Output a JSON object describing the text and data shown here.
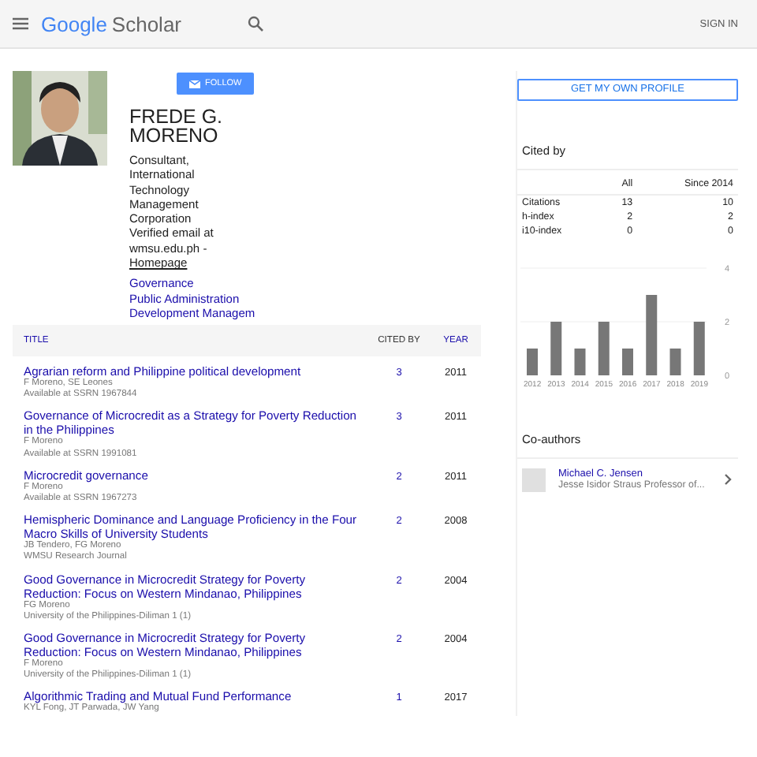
{
  "header": {
    "logo_google": "Google",
    "logo_scholar": "Scholar",
    "sign_in": "SIGN IN"
  },
  "profile": {
    "follow": "FOLLOW",
    "name": "FREDE G. MORENO",
    "affiliation": "Consultant, International Technology Management Corporation",
    "email": "Verified email at wmsu.edu.ph -",
    "homepage": "Homepage",
    "interests": [
      "Governance",
      "Public Administration",
      "Development Managem"
    ]
  },
  "articles": {
    "columns": [
      "TITLE",
      "CITED BY",
      "YEAR"
    ],
    "rows": [
      {
        "title": "Agrarian reform and Philippine political development",
        "authors": "F Moreno, SE Leones",
        "venue": "Available at SSRN 1967844",
        "cited_by": "3",
        "year": "2011"
      },
      {
        "title": "Governance of Microcredit as a Strategy for Poverty Reduction in the Philippines",
        "authors": "F Moreno",
        "venue": "Available at SSRN 1991081",
        "cited_by": "3",
        "year": "2011"
      },
      {
        "title": "Microcredit governance",
        "authors": "F Moreno",
        "venue": "Available at SSRN 1967273",
        "cited_by": "2",
        "year": "2011"
      },
      {
        "title": "Hemispheric Dominance and Language Proficiency in the Four Macro Skills of University Students",
        "authors": "JB Tendero, FG Moreno",
        "venue": "WMSU Research Journal",
        "cited_by": "2",
        "year": "2008"
      },
      {
        "title": "Good Governance in Microcredit Strategy for Poverty Reduction: Focus on Western Mindanao, Philippines",
        "authors": "FG Moreno",
        "venue": "University of the Philippines-Diliman 1 (1)",
        "cited_by": "2",
        "year": "2004"
      },
      {
        "title": "Good Governance in Microcredit Strategy for Poverty Reduction: Focus on Western Mindanao, Philippines",
        "authors": "F Moreno",
        "venue": "University of the Philippines-Diliman 1 (1)",
        "cited_by": "2",
        "year": "2004"
      },
      {
        "title": "Algorithmic Trading and Mutual Fund Performance",
        "authors": "KYL Fong, JT Parwada, JW Yang",
        "cited_by": "1",
        "year": "2017"
      }
    ]
  },
  "sidebar": {
    "get_profile": "GET MY OWN PROFILE",
    "cited_by": {
      "title": "Cited by",
      "columns": [
        "",
        "All",
        "Since 2014"
      ],
      "rows": [
        [
          "Citations",
          "13",
          "10"
        ],
        [
          "h-index",
          "2",
          "2"
        ],
        [
          "i10-index",
          "0",
          "0"
        ]
      ],
      "chart_data": {
        "type": "bar",
        "categories": [
          "2012",
          "2013",
          "2014",
          "2015",
          "2016",
          "2017",
          "2018",
          "2019"
        ],
        "values": [
          1,
          2,
          1,
          2,
          1,
          3,
          1,
          2
        ],
        "ylim": [
          0,
          4
        ],
        "yticks": [
          0,
          2,
          4
        ]
      }
    },
    "coauthors": {
      "title": "Co-authors",
      "items": [
        {
          "name": "Michael C. Jensen",
          "description": "Jesse Isidor Straus Professor of..."
        }
      ]
    }
  }
}
